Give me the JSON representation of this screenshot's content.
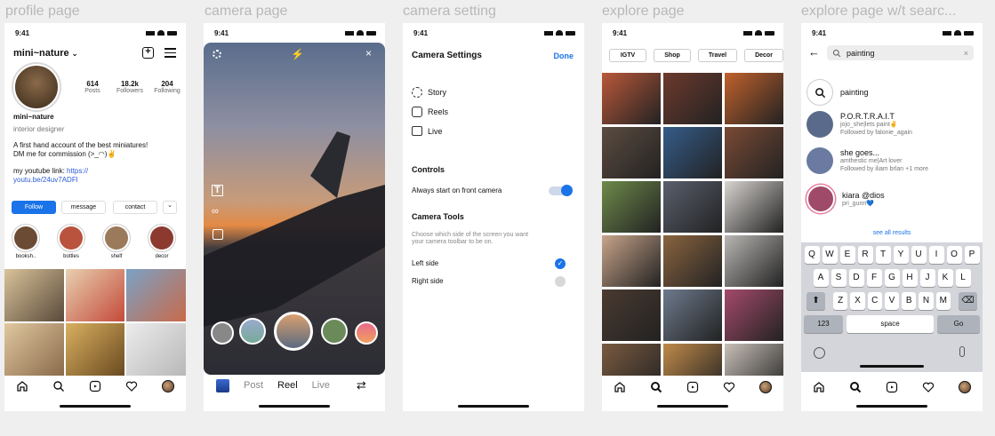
{
  "frames": [
    {
      "label": "profile page"
    },
    {
      "label": "camera page"
    },
    {
      "label": "camera setting"
    },
    {
      "label": "explore page"
    },
    {
      "label": "explore page w/t searc..."
    }
  ],
  "status": {
    "time": "9:41"
  },
  "profile": {
    "username": "mini~nature",
    "stats": [
      {
        "num": "614",
        "label": "Posts"
      },
      {
        "num": "18.2k",
        "label": "Followers"
      },
      {
        "num": "204",
        "label": "Following"
      }
    ],
    "name": "mini~nature",
    "category": "interior designer",
    "bio1": "A first hand account of the best miniatures!",
    "bio2": "DM me for commission (>_◠)✌",
    "link_prefix": "my youtube link: ",
    "link1": "https://",
    "link2": "youtu.be/24uv7ADFl",
    "buttons": {
      "follow": "Follow",
      "message": "message",
      "contact": "contact",
      "more": "⌄"
    },
    "highlights": [
      {
        "label": "booksh..",
        "color": "#6b4b34"
      },
      {
        "label": "bottles",
        "color": "#b9533d"
      },
      {
        "label": "shelf",
        "color": "#9a7a5a"
      },
      {
        "label": "decor",
        "color": "#8c3a30"
      }
    ],
    "grid": [
      "#7b6a52",
      "#c44a3a",
      "#7aa2c6",
      "#d9b58a",
      "#b18a38",
      "#d8d8d8"
    ]
  },
  "camera": {
    "modes": {
      "post": "Post",
      "reel": "Reel",
      "live": "Live"
    }
  },
  "settings": {
    "title": "Camera Settings",
    "done": "Done",
    "items": [
      {
        "label": "Story"
      },
      {
        "label": "Reels"
      },
      {
        "label": "Live"
      }
    ],
    "controls_heading": "Controls",
    "front_camera_label": "Always start on front camera",
    "front_camera_on": true,
    "tools_heading": "Camera Tools",
    "tools_desc1": "Choose which side of the screen you want",
    "tools_desc2": "your camera toolbar to be on.",
    "left_label": "Left side",
    "right_label": "Right side",
    "selected": "left",
    "accent": "#1a73e8"
  },
  "explore": {
    "chips": [
      "IGTV",
      "Shop",
      "Travel",
      "Decor"
    ],
    "grid": [
      "#b9583a",
      "#6d3a2d",
      "#c0612c",
      "#5c4c40",
      "#355c8a",
      "#7a4a35",
      "#6e8a4a",
      "#5a5f6d",
      "#d8d4d0",
      "#c8a48a",
      "#8a6440",
      "#b9b6b3",
      "#4a3a30",
      "#6d7a8d",
      "#a44a6a",
      "#7a5a40",
      "#c08a4a",
      "#c8c0b8"
    ]
  },
  "search": {
    "query": "painting",
    "results": [
      {
        "title": "painting",
        "sub1": "",
        "sub2": "",
        "type": "tag"
      },
      {
        "title": "P.O.R.T.R.A.I.T",
        "sub1": "jojo_she|lets paint✌",
        "sub2": "Followed by falonie_again",
        "color": "#5a6a8a"
      },
      {
        "title": "she goes...",
        "sub1": "amthestic me|Art lover",
        "sub2": "Followed by iliam brlan +1 more",
        "color": "#6a7aa0"
      },
      {
        "title": "kiara @dios",
        "sub1": "pri_gunn💙",
        "sub2": "",
        "color": "#a04a6a"
      }
    ],
    "see_all": "see all results",
    "kb_row1": [
      "Q",
      "W",
      "E",
      "R",
      "T",
      "Y",
      "U",
      "I",
      "O",
      "P"
    ],
    "kb_row2": [
      "A",
      "S",
      "D",
      "F",
      "G",
      "H",
      "J",
      "K",
      "L"
    ],
    "kb_row3": [
      "Z",
      "X",
      "C",
      "V",
      "B",
      "N",
      "M"
    ],
    "kb_123": "123",
    "kb_space": "space",
    "kb_go": "Go"
  }
}
